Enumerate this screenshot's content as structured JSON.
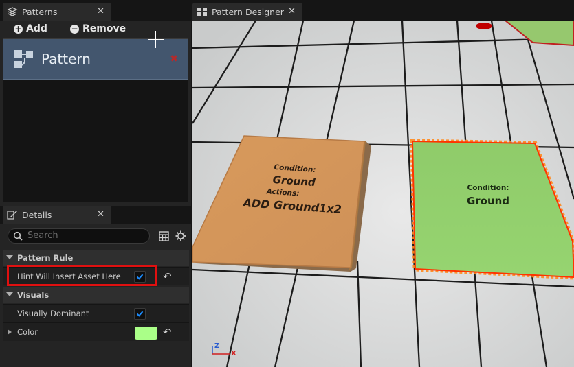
{
  "patterns_panel": {
    "tab_title": "Patterns",
    "close": "✕",
    "toolbar": {
      "add_label": "Add",
      "remove_label": "Remove"
    },
    "items": [
      {
        "name": "Pattern",
        "remove": "✖"
      }
    ]
  },
  "designer": {
    "tab_title": "Pattern Designer",
    "close": "✕",
    "tiles": [
      {
        "condition_label": "Condition:",
        "condition": "Ground",
        "actions_label": "Actions:",
        "action": "ADD Ground1x2"
      },
      {
        "condition_label": "Condition:",
        "condition": "Ground"
      }
    ],
    "axis": {
      "z": "Z",
      "x": "X"
    }
  },
  "details_panel": {
    "tab_title": "Details",
    "close": "✕",
    "search": {
      "placeholder": "Search"
    },
    "categories": [
      {
        "name": "Pattern Rule",
        "rows": [
          {
            "label": "Hint Will Insert Asset Here",
            "checked": true
          }
        ]
      },
      {
        "name": "Visuals",
        "rows": [
          {
            "label": "Visually Dominant",
            "checked": true
          },
          {
            "label": "Color",
            "color": "#aaff88"
          }
        ]
      }
    ]
  },
  "colors": {
    "accent": "#0070e0",
    "highlight": "#e01010",
    "selected": "#43566e",
    "brown_tile": "#d99a5c",
    "green_tile": "#8fcf6a"
  }
}
